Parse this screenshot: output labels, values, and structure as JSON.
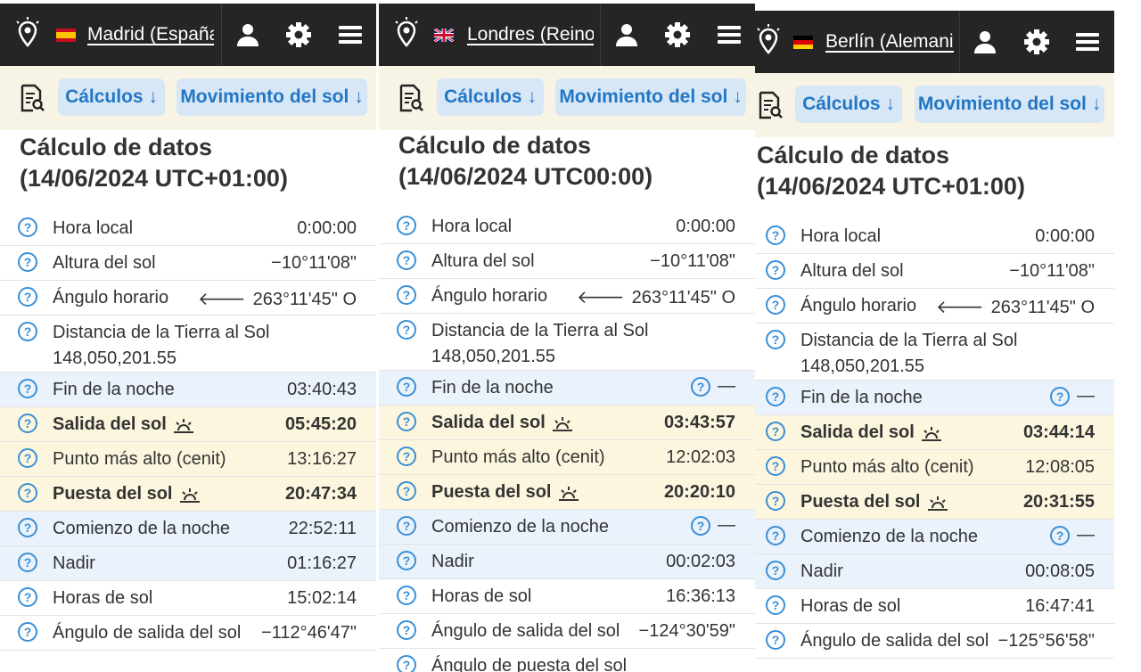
{
  "panels": [
    {
      "city": "Madrid (España)",
      "flag": "es",
      "toolbar": {
        "calc_label": "Cálculos",
        "sun_label": "Movimiento del sol"
      },
      "title_line1": "Cálculo de datos",
      "title_line2": "(14/06/2024 UTC+01:00)",
      "rows": [
        {
          "label": "Hora local",
          "value": "0:00:00",
          "style": ""
        },
        {
          "label": "Altura del sol",
          "value": "−10°11'08\"",
          "style": ""
        },
        {
          "label": "Ángulo horario",
          "value": "263°11'45\" O",
          "style": "",
          "arrow": true
        },
        {
          "label": "Distancia de la Tierra al Sol",
          "value": "148,050,201.55",
          "style": "tall"
        },
        {
          "label": "Fin de la noche",
          "value": "03:40:43",
          "style": "blue"
        },
        {
          "label": "Salida del sol",
          "value": "05:45:20",
          "style": "yel bold",
          "sun": true
        },
        {
          "label": "Punto más alto (cenit)",
          "value": "13:16:27",
          "style": "yel"
        },
        {
          "label": "Puesta del sol",
          "value": "20:47:34",
          "style": "yel bold",
          "sun": true
        },
        {
          "label": "Comienzo de la noche",
          "value": "22:52:11",
          "style": "blue"
        },
        {
          "label": "Nadir",
          "value": "01:16:27",
          "style": "blue"
        },
        {
          "label": "Horas de sol",
          "value": "15:02:14",
          "style": ""
        },
        {
          "label": "Ángulo de salida del sol",
          "value": "−112°46'47\"",
          "style": ""
        }
      ]
    },
    {
      "city": "Londres (Reino U",
      "flag": "gb",
      "toolbar": {
        "calc_label": "Cálculos",
        "sun_label": "Movimiento del sol"
      },
      "title_line1": "Cálculo de datos",
      "title_line2": "(14/06/2024 UTC00:00)",
      "rows": [
        {
          "label": "Hora local",
          "value": "0:00:00",
          "style": ""
        },
        {
          "label": "Altura del sol",
          "value": "−10°11'08\"",
          "style": ""
        },
        {
          "label": "Ángulo horario",
          "value": "263°11'45\" O",
          "style": "",
          "arrow": true
        },
        {
          "label": "Distancia de la Tierra al Sol",
          "value": "148,050,201.55",
          "style": "tall"
        },
        {
          "label": "Fin de la noche",
          "value": "—",
          "style": "blue",
          "help": true
        },
        {
          "label": "Salida del sol",
          "value": "03:43:57",
          "style": "yel bold",
          "sun": true
        },
        {
          "label": "Punto más alto (cenit)",
          "value": "12:02:03",
          "style": "yel"
        },
        {
          "label": "Puesta del sol",
          "value": "20:20:10",
          "style": "yel bold",
          "sun": true
        },
        {
          "label": "Comienzo de la noche",
          "value": "—",
          "style": "blue",
          "help": true
        },
        {
          "label": "Nadir",
          "value": "00:02:03",
          "style": "blue"
        },
        {
          "label": "Horas de sol",
          "value": "16:36:13",
          "style": ""
        },
        {
          "label": "Ángulo de salida del sol",
          "value": "−124°30'59\"",
          "style": ""
        },
        {
          "label": "Ángulo de puesta del sol",
          "value": "",
          "style": ""
        }
      ]
    },
    {
      "city": "Berlín (Alemania)",
      "flag": "de",
      "toolbar": {
        "calc_label": "Cálculos",
        "sun_label": "Movimiento del sol"
      },
      "title_line1": "Cálculo de datos",
      "title_line2": "(14/06/2024 UTC+01:00)",
      "rows": [
        {
          "label": "Hora local",
          "value": "0:00:00",
          "style": ""
        },
        {
          "label": "Altura del sol",
          "value": "−10°11'08\"",
          "style": ""
        },
        {
          "label": "Ángulo horario",
          "value": "263°11'45\" O",
          "style": "",
          "arrow": true
        },
        {
          "label": "Distancia de la Tierra al Sol",
          "value": "148,050,201.55",
          "style": "tall"
        },
        {
          "label": "Fin de la noche",
          "value": "—",
          "style": "blue",
          "help": true
        },
        {
          "label": "Salida del sol",
          "value": "03:44:14",
          "style": "yel bold",
          "sun": true
        },
        {
          "label": "Punto más alto (cenit)",
          "value": "12:08:05",
          "style": "yel"
        },
        {
          "label": "Puesta del sol",
          "value": "20:31:55",
          "style": "yel bold",
          "sun": true
        },
        {
          "label": "Comienzo de la noche",
          "value": "—",
          "style": "blue",
          "help": true
        },
        {
          "label": "Nadir",
          "value": "00:08:05",
          "style": "blue"
        },
        {
          "label": "Horas de sol",
          "value": "16:47:41",
          "style": ""
        },
        {
          "label": "Ángulo de salida del sol",
          "value": "−125°56'58\"",
          "style": ""
        }
      ]
    }
  ],
  "colors": {
    "topbar": "#252525",
    "toolbar": "#f7f3e5",
    "accent": "#2177c6",
    "pill": "#d8e7f6",
    "row_blue": "#eaf2fb",
    "row_yellow": "#fdf6de"
  },
  "icons": {
    "location": "location-pin-icon",
    "user": "user-icon",
    "settings": "gear-icon",
    "menu": "hamburger-menu-icon",
    "report": "document-search-icon",
    "help": "help-circle-icon",
    "sun": "sunrise-icon",
    "arrow": "arrow-left-icon"
  }
}
